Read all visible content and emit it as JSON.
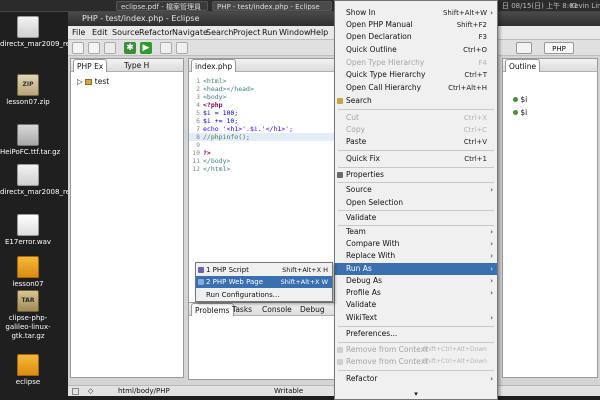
{
  "taskbar": {
    "tabs": [
      "eclipse.pdf - 檔案管理員",
      "PHP - test/index.php - Eclipse"
    ],
    "tray_text": "日 08/15(日) 上午 8:01",
    "user": "Kevin Lin"
  },
  "desktop_icons": [
    {
      "label": "directx_mar2009_redist.exe",
      "icon": "installer-icon",
      "glyph": ""
    },
    {
      "label": "lesson07.zip",
      "icon": "zip-archive-icon",
      "glyph": "ZIP"
    },
    {
      "label": "HeiPoFC.ttf.tar.gz",
      "icon": "archive-icon",
      "glyph": ""
    },
    {
      "label": "directx_mar2008_redist.exe",
      "icon": "installer-icon",
      "glyph": ""
    },
    {
      "label": "E17error.wav",
      "icon": "audio-file-icon",
      "glyph": ""
    },
    {
      "label": "lesson07",
      "icon": "folder-icon",
      "glyph": ""
    },
    {
      "label": "clipse-php-galileo-linux-gtk.tar.gz",
      "icon": "tar-archive-icon",
      "glyph": "TAR"
    },
    {
      "label": "eclipse",
      "icon": "folder-icon",
      "glyph": ""
    }
  ],
  "window": {
    "title": "PHP - test/index.php - Eclipse",
    "menus": [
      "File",
      "Edit",
      "Source",
      "Refactor",
      "Navigate",
      "Search",
      "Project",
      "Run",
      "Window",
      "Help"
    ]
  },
  "explorer": {
    "tabs": [
      "PHP Ex",
      "Type H"
    ],
    "tree_root": "test"
  },
  "editor": {
    "tab": "index.php",
    "lines": [
      {
        "n": "1",
        "code": "<html>"
      },
      {
        "n": "2",
        "code": "<head></head>"
      },
      {
        "n": "3",
        "code": "<body>"
      },
      {
        "n": "4",
        "code": "<?php"
      },
      {
        "n": "5",
        "code": "$i = 100;"
      },
      {
        "n": "6",
        "code": "$i += 10;"
      },
      {
        "n": "7",
        "code": "echo '<h1>'.$i.'</h1>';"
      },
      {
        "n": "8",
        "code": "//phpinfo();"
      },
      {
        "n": "9",
        "code": ""
      },
      {
        "n": "10",
        "code": "?>"
      },
      {
        "n": "11",
        "code": "</body>"
      },
      {
        "n": "12",
        "code": "</html>"
      }
    ]
  },
  "bottom_panel": {
    "tabs": [
      "Problems",
      "Tasks",
      "Console",
      "Debug"
    ]
  },
  "outline": {
    "perspective": "PHP",
    "title": "Outline",
    "items": [
      "$i",
      "$i"
    ]
  },
  "status": {
    "path": "html/body/PHP",
    "mode": "Writable"
  },
  "context_menu": {
    "items": [
      {
        "label": "Show In",
        "shortcut": "Shift+Alt+W",
        "arrow": "›",
        "state": "normal"
      },
      {
        "label": "Open PHP Manual",
        "shortcut": "Shift+F2",
        "arrow": "",
        "state": "normal"
      },
      {
        "label": "Open Declaration",
        "shortcut": "F3",
        "arrow": "",
        "state": "normal"
      },
      {
        "label": "Quick Outline",
        "shortcut": "Ctrl+O",
        "arrow": "",
        "state": "normal"
      },
      {
        "label": "Open Type Hierarchy",
        "shortcut": "F4",
        "arrow": "",
        "state": "disabled"
      },
      {
        "label": "Quick Type Hierarchy",
        "shortcut": "Ctrl+T",
        "arrow": "",
        "state": "normal"
      },
      {
        "label": "Open Call Hierarchy",
        "shortcut": "Ctrl+Alt+H",
        "arrow": "",
        "state": "normal"
      },
      {
        "label": "Search",
        "shortcut": "",
        "arrow": "",
        "state": "normal"
      },
      {
        "label": "Cut",
        "shortcut": "Ctrl+X",
        "arrow": "",
        "state": "disabled"
      },
      {
        "label": "Copy",
        "shortcut": "Ctrl+C",
        "arrow": "",
        "state": "disabled"
      },
      {
        "label": "Paste",
        "shortcut": "Ctrl+V",
        "arrow": "",
        "state": "normal"
      },
      {
        "label": "Quick Fix",
        "shortcut": "Ctrl+1",
        "arrow": "",
        "state": "normal"
      },
      {
        "label": "Properties",
        "shortcut": "",
        "arrow": "",
        "state": "normal"
      },
      {
        "label": "Source",
        "shortcut": "",
        "arrow": "›",
        "state": "normal"
      },
      {
        "label": "Open Selection",
        "shortcut": "",
        "arrow": "",
        "state": "normal"
      },
      {
        "label": "Validate",
        "shortcut": "",
        "arrow": "",
        "state": "normal"
      },
      {
        "label": "Team",
        "shortcut": "",
        "arrow": "›",
        "state": "normal"
      },
      {
        "label": "Compare With",
        "shortcut": "",
        "arrow": "›",
        "state": "normal"
      },
      {
        "label": "Replace With",
        "shortcut": "",
        "arrow": "›",
        "state": "normal"
      },
      {
        "label": "Run As",
        "shortcut": "",
        "arrow": "›",
        "state": "selected"
      },
      {
        "label": "Debug As",
        "shortcut": "",
        "arrow": "›",
        "state": "normal"
      },
      {
        "label": "Profile As",
        "shortcut": "",
        "arrow": "›",
        "state": "normal"
      },
      {
        "label": "Validate",
        "shortcut": "",
        "arrow": "",
        "state": "normal"
      },
      {
        "label": "WikiText",
        "shortcut": "",
        "arrow": "›",
        "state": "normal"
      },
      {
        "label": "Preferences...",
        "shortcut": "",
        "arrow": "",
        "state": "normal"
      },
      {
        "label": "Remove from Context",
        "shortcut": "Shift+Ctrl+Alt+Down",
        "arrow": "",
        "state": "disabled"
      },
      {
        "label": "Remove from Context",
        "shortcut": "Shift+Ctrl+Alt+Down",
        "arrow": "",
        "state": "disabled"
      },
      {
        "label": "Refactor",
        "shortcut": "",
        "arrow": "›",
        "state": "normal"
      }
    ]
  },
  "submenu": {
    "items": [
      {
        "label": "1 PHP Script",
        "shortcut": "Shift+Alt+X H"
      },
      {
        "label": "2 PHP Web Page",
        "shortcut": "Shift+Alt+X W"
      },
      {
        "label": "Run Configurations...",
        "shortcut": ""
      }
    ]
  },
  "colors": {
    "selection": "#3a6fb0",
    "php_keyword": "#7f0055",
    "php_variable": "#0000c0",
    "php_string": "#2a00ff",
    "html_tag": "#3f7f7f",
    "comment": "#3f7f5f"
  }
}
